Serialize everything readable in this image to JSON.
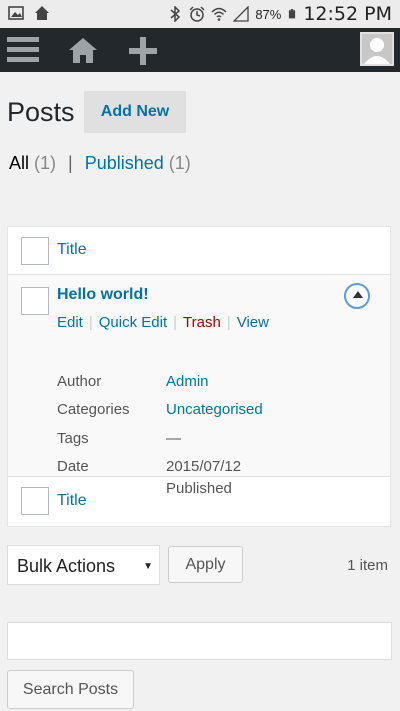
{
  "status_bar": {
    "icons_left": [
      "gallery-icon",
      "home-icon"
    ],
    "icons_right": [
      "bluetooth-icon",
      "alarm-icon",
      "wifi-icon",
      "signal-icon",
      "battery-icon"
    ],
    "battery": "87%",
    "time": "12:52 PM"
  },
  "admin_bar": {
    "background": "#23282d",
    "icons": [
      "menu-icon",
      "home-icon",
      "plus-icon",
      "avatar-icon"
    ]
  },
  "page": {
    "title": "Posts",
    "add_new": "Add New"
  },
  "filters": {
    "all_label": "All",
    "all_count": "(1)",
    "separator": "|",
    "published_label": "Published",
    "published_count": "(1)"
  },
  "table": {
    "column_title": "Title",
    "footer_title": "Title",
    "post": {
      "title": "Hello world!",
      "actions": [
        "Edit",
        "Quick Edit",
        "Trash",
        "View"
      ],
      "meta": [
        {
          "label": "Author",
          "value": "Admin"
        },
        {
          "label": "Categories",
          "value": "Uncategorised"
        },
        {
          "label": "Tags",
          "value": "—"
        },
        {
          "label": "Date",
          "value": "2015/07/12",
          "value2": "Published"
        }
      ]
    }
  },
  "bulk": {
    "selected": "Bulk Actions",
    "apply": "Apply",
    "count": "1 item"
  },
  "search": {
    "placeholder": "",
    "button": "Search Posts"
  },
  "colors": {
    "link": "#0073aa",
    "trash": "#aa0000",
    "toggle_ring": "#5b9dd9"
  }
}
